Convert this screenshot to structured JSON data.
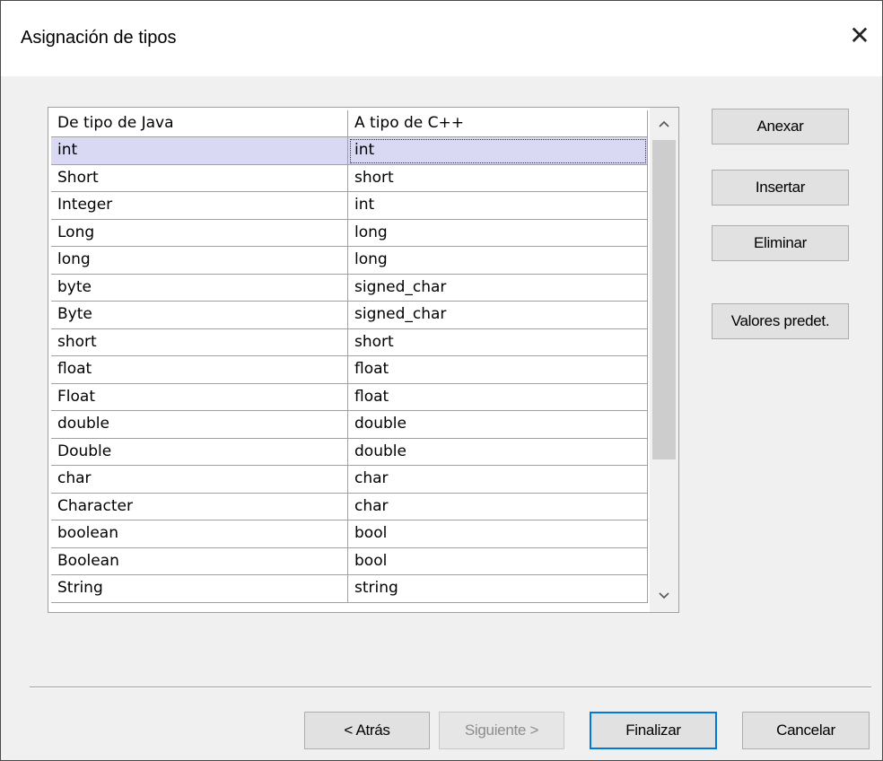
{
  "dialog": {
    "title": "Asignación de tipos",
    "close_glyph": "✕"
  },
  "table": {
    "columns": [
      "De tipo de Java",
      "A tipo de C++"
    ],
    "rows": [
      [
        "int",
        "int"
      ],
      [
        "Short",
        "short"
      ],
      [
        "Integer",
        "int"
      ],
      [
        "Long",
        "long"
      ],
      [
        "long",
        "long"
      ],
      [
        "byte",
        "signed_char"
      ],
      [
        "Byte",
        "signed_char"
      ],
      [
        "short",
        "short"
      ],
      [
        "float",
        "float"
      ],
      [
        "Float",
        "float"
      ],
      [
        "double",
        "double"
      ],
      [
        "Double",
        "double"
      ],
      [
        "char",
        "char"
      ],
      [
        "Character",
        "char"
      ],
      [
        "boolean",
        "bool"
      ],
      [
        "Boolean",
        "bool"
      ],
      [
        "String",
        "string"
      ]
    ],
    "selected_row": 0,
    "scroll_up_glyph": "^",
    "scroll_down_glyph": "v"
  },
  "side_buttons": {
    "append": "Anexar",
    "insert": "Insertar",
    "delete": "Eliminar",
    "defaults": "Valores predet."
  },
  "footer": {
    "back": "< Atrás",
    "next": "Siguiente >",
    "finish": "Finalizar",
    "cancel": "Cancelar"
  }
}
